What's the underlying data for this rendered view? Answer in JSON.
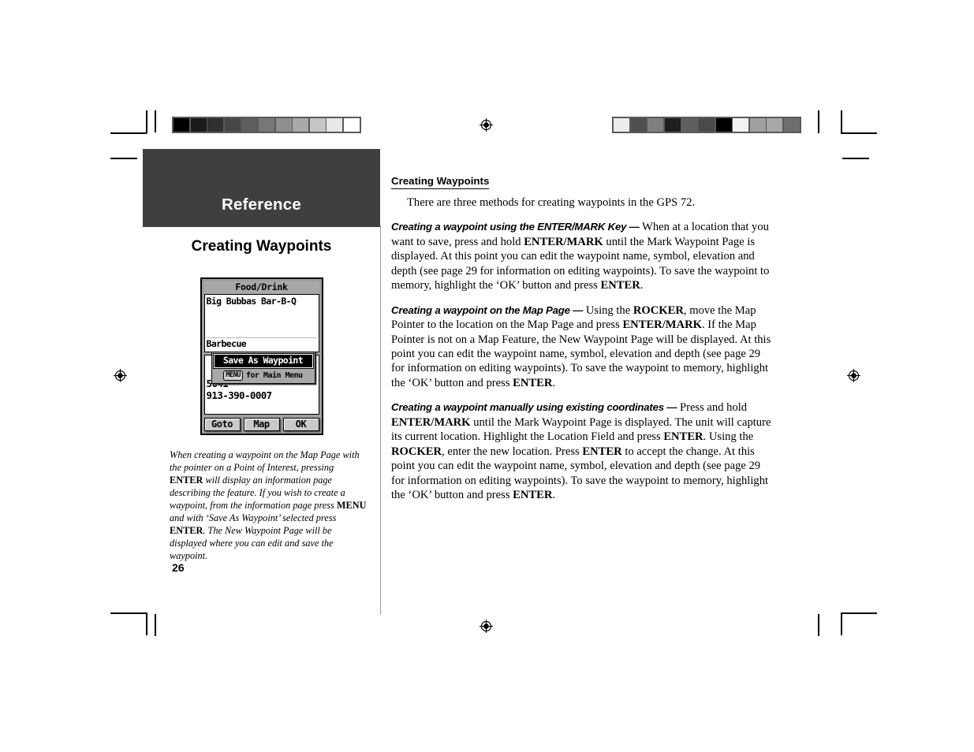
{
  "document": {
    "folio": "26",
    "chapter_band_label": "Reference",
    "section_title": "Creating Waypoints"
  },
  "prepress": {
    "calibration_left": [
      "#000000",
      "#1a1a1a",
      "#303030",
      "#474747",
      "#5e5e5e",
      "#777777",
      "#8f8f8f",
      "#a9a9a9",
      "#c6c6c6",
      "#e8e8e8",
      "#ffffff"
    ],
    "calibration_right": [
      "#ececec",
      "#4f4f4f",
      "#808080",
      "#1f1f1f",
      "#5f5f5f",
      "#4a4a4a",
      "#000000",
      "#f2f2f2",
      "#a0a0a0",
      "#a8a8a8",
      "#6e6e6e"
    ],
    "bar_frame_color": "#5a5a5a",
    "registration_mark_name": "registration-target"
  },
  "figure": {
    "device_screen": {
      "titlebar": "Food/Drink",
      "poi_name": "Big Bubbas Bar-B-Q",
      "category": "Barbecue",
      "address_line": "5641",
      "phone": "913-390-0007",
      "popup": {
        "selected_item": "Save As Waypoint",
        "hint_key": "MENU",
        "hint_text": "for Main Menu"
      },
      "buttons": [
        "Goto",
        "Map",
        "OK"
      ]
    },
    "caption_parts": [
      {
        "t": "When creating a waypoint on the Map Page with the pointer on a Point of Interest, pressing ",
        "b": false
      },
      {
        "t": "ENTER",
        "b": true
      },
      {
        "t": " will display an information page describing the feature.  If you wish to create a waypoint, from the information page press ",
        "b": false
      },
      {
        "t": "MENU",
        "b": true
      },
      {
        "t": " and with ‘Save As Waypoint’ selected press ",
        "b": false
      },
      {
        "t": "ENTER",
        "b": true
      },
      {
        "t": ".  The New Waypoint Page will be displayed where you can edit and save the waypoint.",
        "b": false
      }
    ]
  },
  "body": {
    "heading": "Creating Waypoints",
    "intro": "There are three methods for creating waypoints in the GPS 72.",
    "paragraphs": [
      {
        "runin": "Creating a waypoint using the ENTER/MARK Key —",
        "parts": [
          {
            "t": "  When at a location that you want to save, press and hold ",
            "b": false
          },
          {
            "t": "ENTER/MARK",
            "b": true
          },
          {
            "t": " until the Mark Waypoint Page is displayed.  At this point you can edit the waypoint name, symbol, elevation and depth (see page 29 for information on editing waypoints).  To save the waypoint to memory, highlight the ‘OK’ button and press ",
            "b": false
          },
          {
            "t": "ENTER",
            "b": true
          },
          {
            "t": ".",
            "b": false
          }
        ]
      },
      {
        "runin": "Creating a waypoint on the Map Page —",
        "parts": [
          {
            "t": "  Using the ",
            "b": false
          },
          {
            "t": "ROCKER",
            "b": true
          },
          {
            "t": ", move the Map Pointer to the location on the Map Page and press ",
            "b": false
          },
          {
            "t": "ENTER/MARK",
            "b": true
          },
          {
            "t": ".  If the Map Pointer is not on a Map Feature, the New Waypoint Page will be displayed.  At this point you can edit the waypoint name, symbol, elevation and depth (see page 29 for information on editing waypoints).  To save the waypoint to memory, highlight the ‘OK’ button and press ",
            "b": false
          },
          {
            "t": "ENTER",
            "b": true
          },
          {
            "t": ".",
            "b": false
          }
        ]
      },
      {
        "runin": "Creating a waypoint manually using existing coordinates —",
        "parts": [
          {
            "t": "  Press and hold ",
            "b": false
          },
          {
            "t": "ENTER/MARK",
            "b": true
          },
          {
            "t": " until the Mark Waypoint Page is displayed.  The unit will capture its current location.  Highlight the Location Field and press ",
            "b": false
          },
          {
            "t": "ENTER",
            "b": true
          },
          {
            "t": ".  Using the ",
            "b": false
          },
          {
            "t": "ROCKER",
            "b": true
          },
          {
            "t": ", enter the new location.  Press ",
            "b": false
          },
          {
            "t": "ENTER",
            "b": true
          },
          {
            "t": " to accept the change.  At this point you can edit the waypoint name, symbol, elevation and depth (see page 29 for information on editing waypoints).  To save the waypoint to memory, highlight the ‘OK’ button and press ",
            "b": false
          },
          {
            "t": "ENTER",
            "b": true
          },
          {
            "t": ".",
            "b": false
          }
        ]
      }
    ]
  }
}
